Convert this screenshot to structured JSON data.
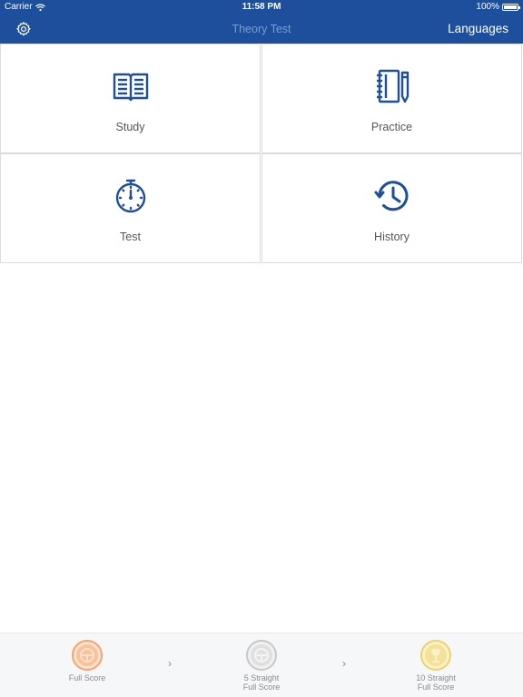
{
  "status_bar": {
    "carrier": "Carrier",
    "time": "11:58 PM",
    "battery": "100%"
  },
  "nav": {
    "title": "Theory Test",
    "languages_label": "Languages",
    "settings_icon": "gear-icon"
  },
  "menu": {
    "study": {
      "label": "Study",
      "icon": "book-icon"
    },
    "practice": {
      "label": "Practice",
      "icon": "notebook-pencil-icon"
    },
    "test": {
      "label": "Test",
      "icon": "stopwatch-icon"
    },
    "history": {
      "label": "History",
      "icon": "history-icon"
    }
  },
  "achievements": [
    {
      "line1": "Full Score",
      "line2": "",
      "color": "#f5a46a"
    },
    {
      "line1": "5 Straight",
      "line2": "Full Score",
      "color": "#c8c8c8"
    },
    {
      "line1": "10 Straight",
      "line2": "Full Score",
      "color": "#ecd36a"
    }
  ],
  "colors": {
    "brand": "#1d4f9c",
    "icon_blue": "#1d4f9c",
    "title_muted": "#7c9ccb"
  }
}
